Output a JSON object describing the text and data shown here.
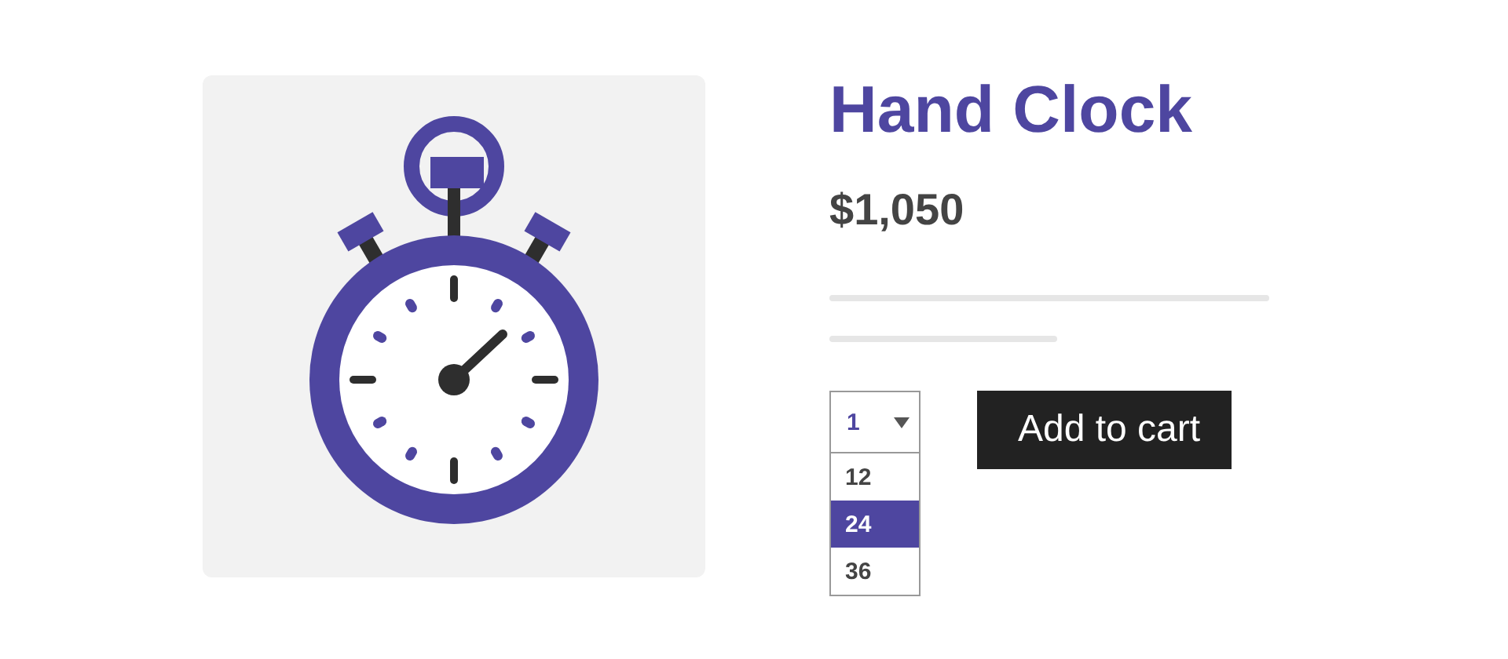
{
  "product": {
    "title": "Hand Clock",
    "price": "$1,050"
  },
  "quantity": {
    "value": "1",
    "expanded": true,
    "options": [
      {
        "label": "12",
        "selected": false
      },
      {
        "label": "24",
        "selected": true
      },
      {
        "label": "36",
        "selected": false
      }
    ]
  },
  "button": "Add to cart"
}
